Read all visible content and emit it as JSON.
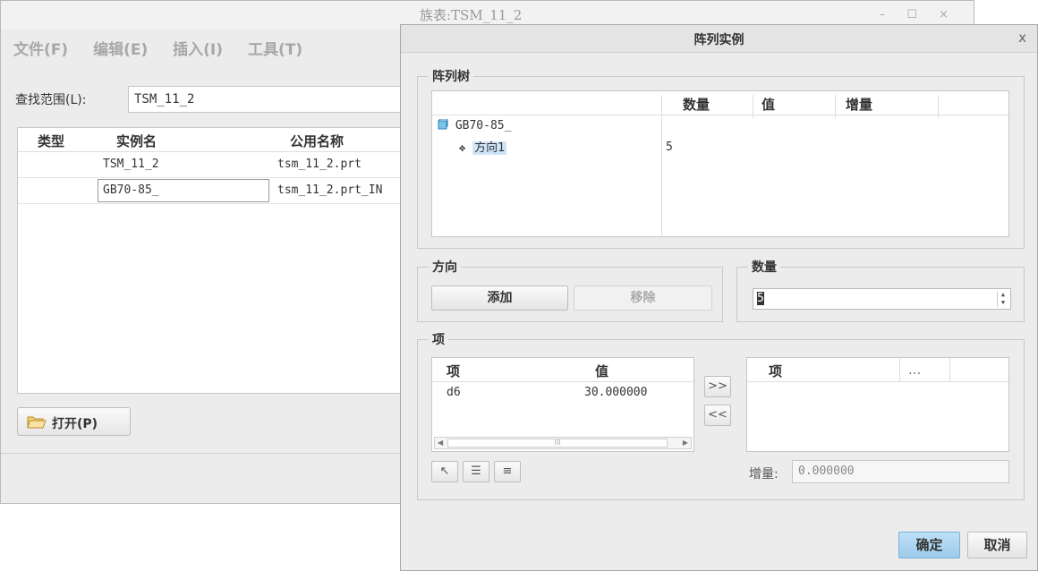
{
  "bg_window": {
    "title": "族表:TSM_11_2",
    "menu": [
      "文件(F)",
      "编辑(E)",
      "插入(I)",
      "工具(T)"
    ],
    "scope_label": "查找范围(L):",
    "scope_value": "TSM_11_2",
    "table": {
      "headers": [
        "类型",
        "实例名",
        "公用名称"
      ],
      "rows": [
        [
          "",
          "TSM_11_2",
          "tsm_11_2.prt"
        ],
        [
          "",
          "GB70-85_",
          "tsm_11_2.prt_IN"
        ]
      ]
    },
    "open_button": "打开(P)"
  },
  "dialog": {
    "title": "阵列实例",
    "close": "x",
    "tree_group": "阵列树",
    "tree": {
      "headers": [
        "数量",
        "值",
        "增量"
      ],
      "root": "GB70-85_",
      "child": "方向1",
      "child_count": "5"
    },
    "direction_group": "方向",
    "add_button": "添加",
    "remove_button": "移除",
    "count_group": "数量",
    "count_value": "5",
    "items_group": "项",
    "left_list": {
      "headers": [
        "项",
        "值"
      ],
      "rows": [
        [
          "d6",
          "30.000000"
        ]
      ],
      "scroll_thumb": "III"
    },
    "move_right": ">>",
    "move_left": "<<",
    "right_list": {
      "headers": [
        "项",
        "..."
      ]
    },
    "increment_label": "增量:",
    "increment_value": "0.000000",
    "ok_button": "确定",
    "cancel_button": "取消"
  },
  "colors": {
    "ok_accent": "#a9d3f0",
    "selection": "#cfe4f7"
  }
}
